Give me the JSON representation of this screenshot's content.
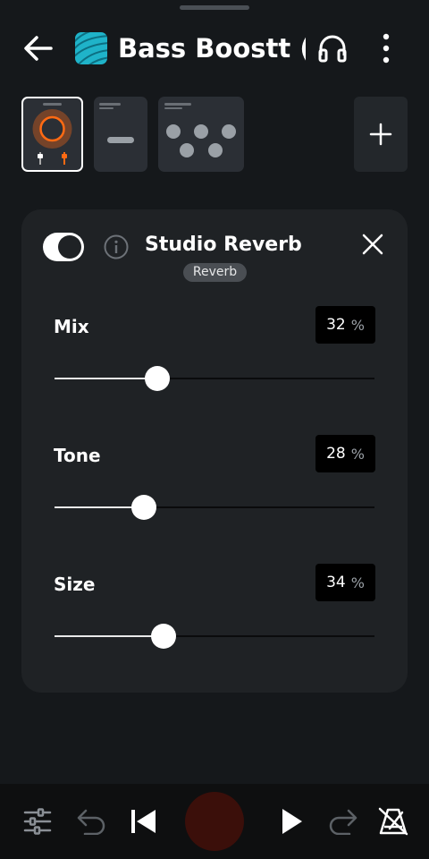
{
  "header": {
    "title": "Bass Boostt (…"
  },
  "icons": {
    "back": "arrow-left-icon",
    "app": "app-logo-icon",
    "headphones": "headphones-icon",
    "more": "more-vertical-icon",
    "add": "plus-icon",
    "info": "info-icon",
    "close": "close-icon",
    "mixer": "sliders-icon",
    "undo": "undo-icon",
    "skip_back": "skip-back-icon",
    "play": "play-icon",
    "redo": "redo-icon",
    "metronome": "metronome-icon"
  },
  "effect_chain": [
    {
      "name": "effect-thumb-knob",
      "selected": true
    },
    {
      "name": "effect-thumb-slider",
      "selected": false
    },
    {
      "name": "effect-thumb-knobs",
      "selected": false
    }
  ],
  "effect": {
    "enabled": true,
    "title": "Studio Reverb",
    "badge": "Reverb",
    "params": [
      {
        "label": "Mix",
        "value": "32",
        "unit": "%",
        "level": 0.32
      },
      {
        "label": "Tone",
        "value": "28",
        "unit": "%",
        "level": 0.28
      },
      {
        "label": "Size",
        "value": "34",
        "unit": "%",
        "level": 0.34
      }
    ]
  },
  "colors": {
    "background": "#15181b",
    "card": "#1f2225",
    "accent_orange": "#ff6a13",
    "app_icon": "#1fb3c9",
    "record": "#3b0f0a"
  }
}
